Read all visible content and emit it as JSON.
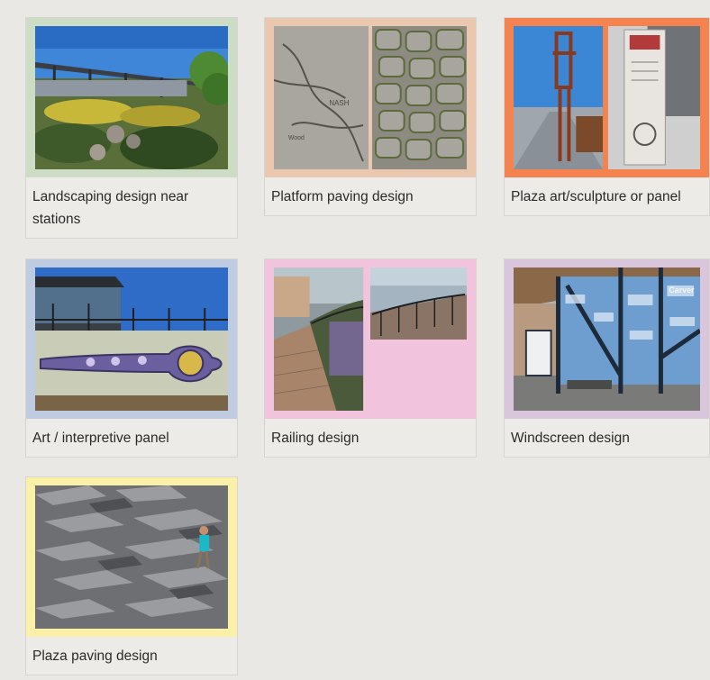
{
  "gallery": {
    "items": [
      {
        "caption": "Landscaping design near stations",
        "frame_color": "#cddcc4",
        "image": "station-landscaping-photo"
      },
      {
        "caption": "Platform paving design",
        "frame_color": "#eac8b0",
        "image": "platform-paving-photo"
      },
      {
        "caption": "Plaza art/sculpture or panel",
        "frame_color": "#f4834f",
        "image": "plaza-sculpture-photo"
      },
      {
        "caption": "Art / interpretive panel",
        "frame_color": "#bfcbe0",
        "image": "interpretive-panel-photo"
      },
      {
        "caption": "Railing design",
        "frame_color": "#f2c3dc",
        "image": "railing-photo"
      },
      {
        "caption": "Windscreen design",
        "frame_color": "#d9c6dc",
        "image": "windscreen-photo"
      },
      {
        "caption": "Plaza paving design",
        "frame_color": "#fbf0a8",
        "image": "plaza-paving-photo"
      }
    ]
  }
}
